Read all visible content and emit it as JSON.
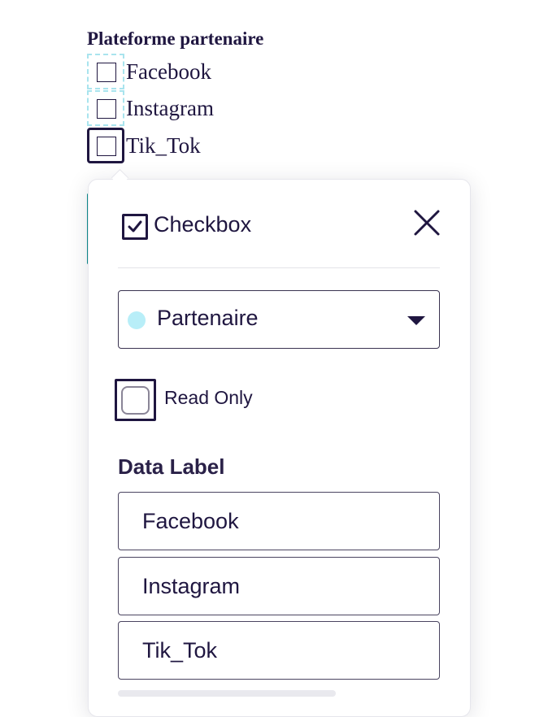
{
  "document": {
    "group_title": "Plateforme partenaire",
    "options": [
      {
        "label": "Facebook"
      },
      {
        "label": "Instagram"
      },
      {
        "label": "Tik_Tok"
      }
    ]
  },
  "panel": {
    "title": "Checkbox",
    "icon": "checkbox-icon",
    "close_icon": "close-icon",
    "recipient": {
      "value": "Partenaire",
      "color": "#b8eef8",
      "arrow_icon": "caret-down-icon"
    },
    "read_only": {
      "label": "Read Only",
      "checked": false
    },
    "data_label": {
      "title": "Data Label",
      "values": [
        "Facebook",
        "Instagram",
        "Tik_Tok"
      ]
    }
  },
  "colors": {
    "text": "#1f1640",
    "field_dashed": "#a9e4ee",
    "accent_teal": "#0f8f8f"
  }
}
